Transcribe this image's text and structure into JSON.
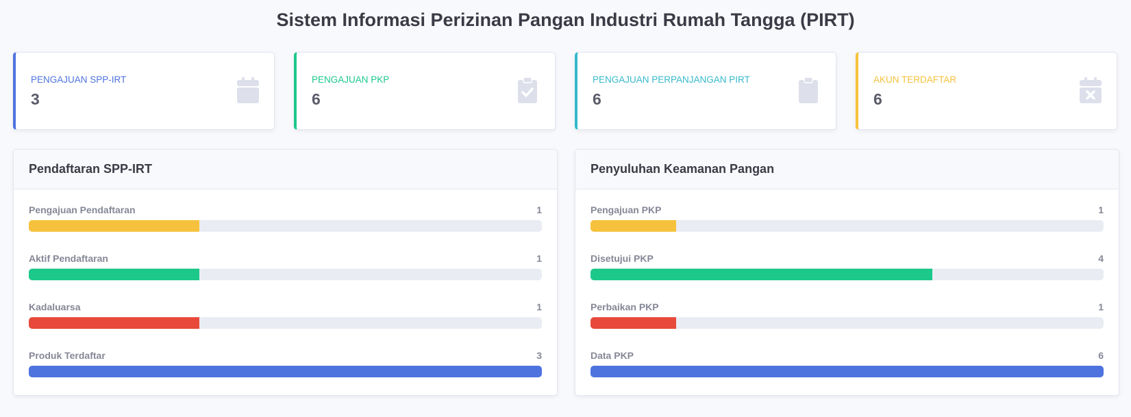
{
  "page_title": "Sistem Informasi Perizinan Pangan Industri Rumah Tangga (PIRT)",
  "stats": [
    {
      "label": "PENGAJUAN SPP-IRT",
      "value": "3",
      "color": "#4e73df",
      "icon": "calendar-icon"
    },
    {
      "label": "PENGAJUAN PKP",
      "value": "6",
      "color": "#1cc88a",
      "icon": "clipboard-check-icon"
    },
    {
      "label": "PENGAJUAN PERPANJANGAN PIRT",
      "value": "6",
      "color": "#36b9cc",
      "icon": "clipboard-icon"
    },
    {
      "label": "AKUN TERDAFTAR",
      "value": "6",
      "color": "#f6c23e",
      "icon": "calendar-times-icon"
    }
  ],
  "panels": [
    {
      "title": "Pendaftaran SPP-IRT",
      "rows": [
        {
          "label": "Pengajuan Pendaftaran",
          "value": "1",
          "fraction": 0.333,
          "color": "#f6c23e"
        },
        {
          "label": "Aktif Pendaftaran",
          "value": "1",
          "fraction": 0.333,
          "color": "#1cc88a"
        },
        {
          "label": "Kadaluarsa",
          "value": "1",
          "fraction": 0.333,
          "color": "#e74a3b"
        },
        {
          "label": "Produk Terdaftar",
          "value": "3",
          "fraction": 1.0,
          "color": "#4e73df"
        }
      ]
    },
    {
      "title": "Penyuluhan Keamanan Pangan",
      "rows": [
        {
          "label": "Pengajuan PKP",
          "value": "1",
          "fraction": 0.1667,
          "color": "#f6c23e"
        },
        {
          "label": "Disetujui PKP",
          "value": "4",
          "fraction": 0.6667,
          "color": "#1cc88a"
        },
        {
          "label": "Perbaikan PKP",
          "value": "1",
          "fraction": 0.1667,
          "color": "#e74a3b"
        },
        {
          "label": "Data PKP",
          "value": "6",
          "fraction": 1.0,
          "color": "#4e73df"
        }
      ]
    }
  ]
}
